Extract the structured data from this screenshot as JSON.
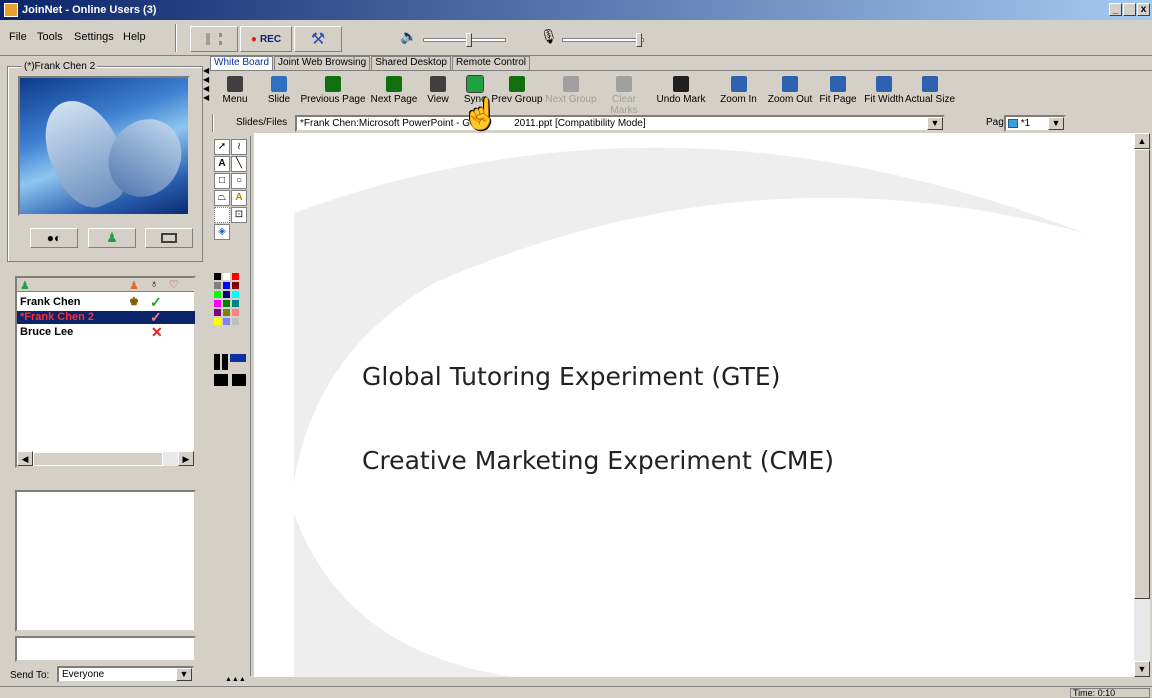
{
  "window": {
    "title": "JoinNet - Online Users (3)",
    "min": "_",
    "max": " ",
    "close": "x"
  },
  "menu": {
    "file": "File",
    "tools": "Tools",
    "settings": "Settings",
    "help": "Help"
  },
  "toolbar": {
    "rec_label": "REC"
  },
  "video": {
    "group_title": "(*)Frank Chen 2"
  },
  "users": [
    {
      "name": "Frank Chen",
      "status": "✓",
      "status_color": "#20a020",
      "role": "♚",
      "color": "#000"
    },
    {
      "name": "*Frank Chen 2",
      "status": "✓",
      "status_color": "#ff6060",
      "role": "",
      "color": "#ff3030"
    },
    {
      "name": "Bruce Lee",
      "status": "✕",
      "status_color": "#e02020",
      "role": "",
      "color": "#000"
    }
  ],
  "chat": {
    "send_to_label": "Send To:",
    "send_to_value": "Everyone"
  },
  "tabs": [
    "White Board",
    "Joint Web Browsing",
    "Shared Desktop",
    "Remote Control"
  ],
  "tools": [
    {
      "label": "Menu",
      "icon": "menu-icon",
      "color": "#404040",
      "enabled": true
    },
    {
      "label": "Slide",
      "icon": "slide-icon",
      "color": "#3070c0",
      "enabled": true
    },
    {
      "label": "Previous Page",
      "icon": "previous-page-icon",
      "color": "#107010",
      "enabled": true
    },
    {
      "label": "Next Page",
      "icon": "next-page-icon",
      "color": "#107010",
      "enabled": true
    },
    {
      "label": "View",
      "icon": "view-icon",
      "color": "#404040",
      "enabled": true
    },
    {
      "label": "Sync",
      "icon": "sync-icon",
      "color": "#20a040",
      "enabled": true
    },
    {
      "label": "Prev Group",
      "icon": "prev-group-icon",
      "color": "#107010",
      "enabled": true
    },
    {
      "label": "Next Group",
      "icon": "next-group-icon",
      "color": "#a0a0a0",
      "enabled": false
    },
    {
      "label": "Clear Marks",
      "icon": "clear-marks-icon",
      "color": "#a0a0a0",
      "enabled": false
    },
    {
      "label": "Undo Mark",
      "icon": "undo-mark-icon",
      "color": "#202020",
      "enabled": true
    },
    {
      "label": "Zoom In",
      "icon": "zoom-in-icon",
      "color": "#3060b0",
      "enabled": true
    },
    {
      "label": "Zoom Out",
      "icon": "zoom-out-icon",
      "color": "#3060b0",
      "enabled": true
    },
    {
      "label": "Fit Page",
      "icon": "fit-page-icon",
      "color": "#3060b0",
      "enabled": true
    },
    {
      "label": "Fit Width",
      "icon": "fit-width-icon",
      "color": "#3060b0",
      "enabled": true
    },
    {
      "label": "Actual Size",
      "icon": "actual-size-icon",
      "color": "#3060b0",
      "enabled": true
    }
  ],
  "slides": {
    "label": "Slides/Files",
    "value": "*Frank Chen:Microsoft PowerPoint - G",
    "value_suffix": "2011.ppt [Compatibility Mode]",
    "page_label": "Page",
    "page_value": "*1"
  },
  "slide": {
    "line1": "Global Tutoring Experiment (GTE)",
    "line2": "Creative Marketing Experiment (CME)"
  },
  "status": {
    "time": "Time: 0:10"
  },
  "colors": {
    "titlebar": "#0a246a",
    "selection": "#0a246a",
    "palette": [
      "#000000",
      "#ffffff",
      "#ff0000",
      "#808080",
      "#0000ff",
      "#800000",
      "#00ff00",
      "#000080",
      "#00ffff",
      "#ff00ff",
      "#008000",
      "#008080",
      "#800080",
      "#808000",
      "#ff8080",
      "#ffff00",
      "#8080ff",
      "#c0c0c0"
    ]
  }
}
